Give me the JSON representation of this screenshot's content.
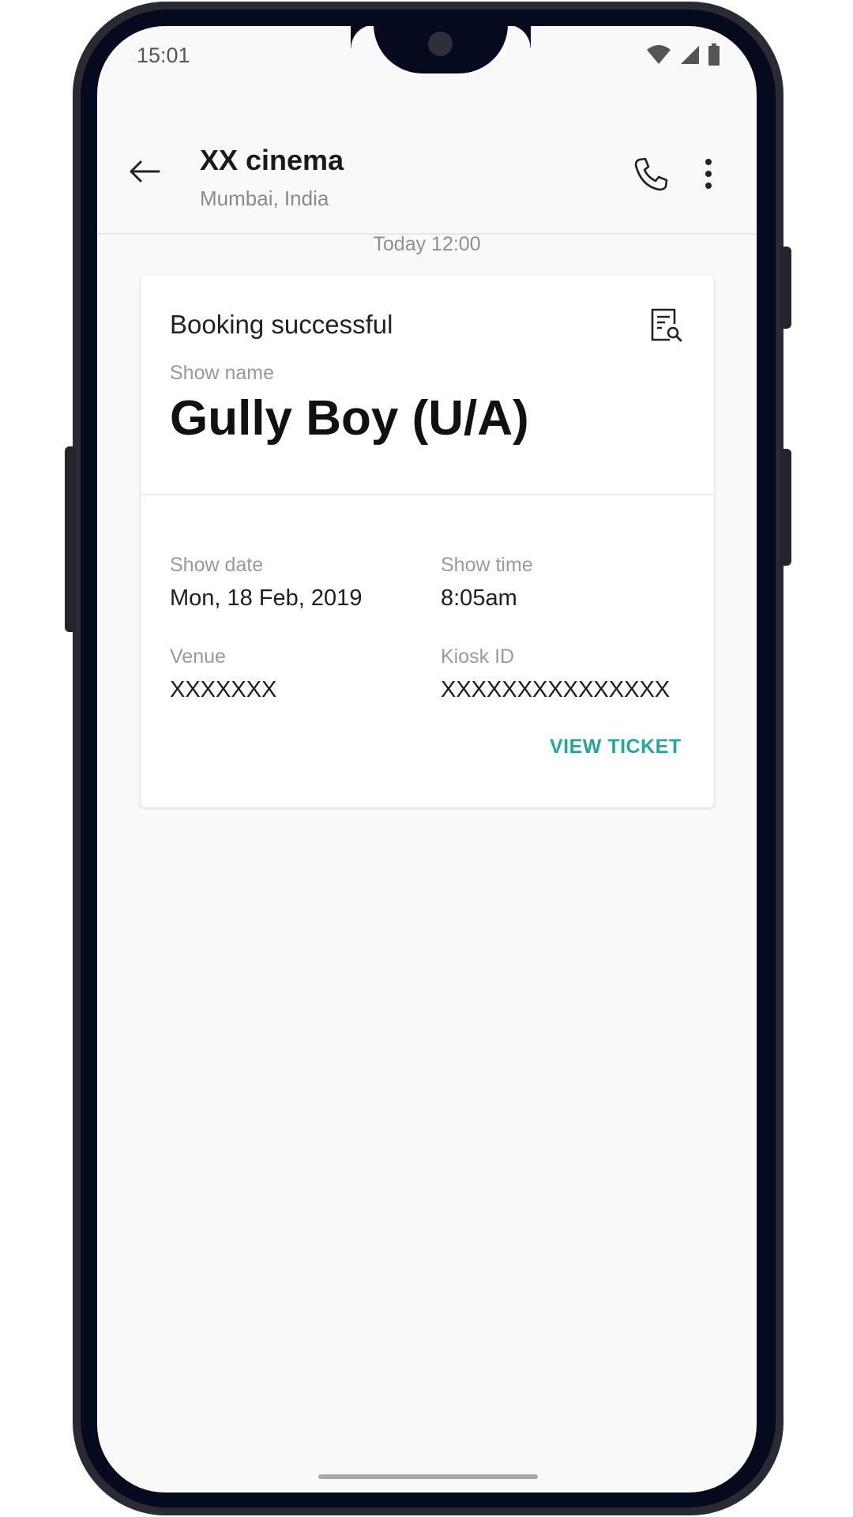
{
  "status_bar": {
    "time": "15:01",
    "icons": [
      "wifi-icon",
      "cell-signal-icon",
      "battery-icon"
    ]
  },
  "header": {
    "title": "XX cinema",
    "subtitle": "Mumbai, India",
    "back_icon": "arrow-left-icon",
    "call_icon": "phone-icon",
    "menu_icon": "more-vertical-icon"
  },
  "conversation": {
    "timestamp": "Today 12:00"
  },
  "card": {
    "heading": "Booking successful",
    "heading_icon": "document-search-icon",
    "show_name_label": "Show name",
    "show_name": "Gully Boy (U/A)",
    "fields": [
      {
        "label": "Show date",
        "value": "Mon, 18 Feb, 2019"
      },
      {
        "label": "Show time",
        "value": "8:05am"
      },
      {
        "label": "Venue",
        "value": "XXXXXXX"
      },
      {
        "label": "Kiosk ID",
        "value": "XXXXXXXXXXXXXXX"
      }
    ],
    "action_label": "VIEW TICKET"
  },
  "colors": {
    "accent": "#26a69a",
    "background": "#f9f9f9",
    "phone_frame": "#050a1e"
  }
}
